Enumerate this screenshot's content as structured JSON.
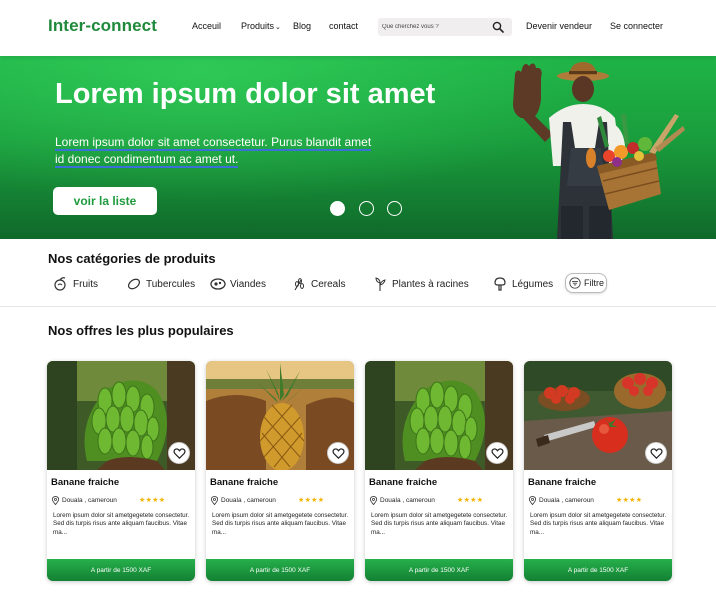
{
  "header": {
    "logo": "Inter-connect",
    "nav": {
      "accueil": "Acceuil",
      "produits": "Produits",
      "blog": "Blog",
      "contact": "contact",
      "vendeur": "Devenir vendeur",
      "connect": "Se connecter"
    },
    "search": {
      "placeholder": "Que cherchez vous ?",
      "value": ""
    }
  },
  "hero": {
    "title": "Lorem ipsum dolor sit amet",
    "subtitle_line1": "Lorem ipsum dolor sit amet consectetur. Purus blandit amet",
    "subtitle_line2": "id donec condimentum ac amet ut.",
    "button": "voir la liste",
    "slides": 3,
    "active_slide": 1
  },
  "categories": {
    "title": "Nos catégories de produits",
    "items": [
      {
        "label": "Fruits",
        "icon": "fruits-icon"
      },
      {
        "label": "Tubercules",
        "icon": "tuber-icon"
      },
      {
        "label": "Viandes",
        "icon": "meat-icon"
      },
      {
        "label": "Cereals",
        "icon": "cereals-icon"
      },
      {
        "label": "Plantes à racines",
        "icon": "plant-icon"
      },
      {
        "label": "Légumes",
        "icon": "vegetables-icon"
      }
    ],
    "filter": "Filtre"
  },
  "offers": {
    "title": "Nos offres les plus populaires",
    "cards": [
      {
        "name": "Banane fraiche",
        "location": "Douala , cameroun",
        "rating": 4,
        "description": "Lorem ipsum dolor sit ametgegetete consectetur. Sed dis turpis risus ante aliquam faucibus. Vitae ma...",
        "price": "A partir de 1500 XAF",
        "image": "bananas"
      },
      {
        "name": "Banane fraiche",
        "location": "Douala , cameroun",
        "rating": 4,
        "description": "Lorem ipsum dolor sit ametgegetete consectetur. Sed dis turpis risus ante aliquam faucibus. Vitae ma...",
        "price": "A partir de 1500 XAF",
        "image": "pineapple"
      },
      {
        "name": "Banane fraiche",
        "location": "Douala , cameroun",
        "rating": 4,
        "description": "Lorem ipsum dolor sit ametgegetete consectetur. Sed dis turpis risus ante aliquam faucibus. Vitae ma...",
        "price": "A partir de 1500 XAF",
        "image": "bananas"
      },
      {
        "name": "Banane fraiche",
        "location": "Douala , cameroun",
        "rating": 4,
        "description": "Lorem ipsum dolor sit ametgegetete consectetur. Sed dis turpis risus ante aliquam faucibus. Vitae ma...",
        "price": "A partir de 1500 XAF",
        "image": "tomatoes"
      }
    ]
  },
  "colors": {
    "brand": "#1f8a3b",
    "hero_green": "#1fb447",
    "star": "#f5b301"
  }
}
